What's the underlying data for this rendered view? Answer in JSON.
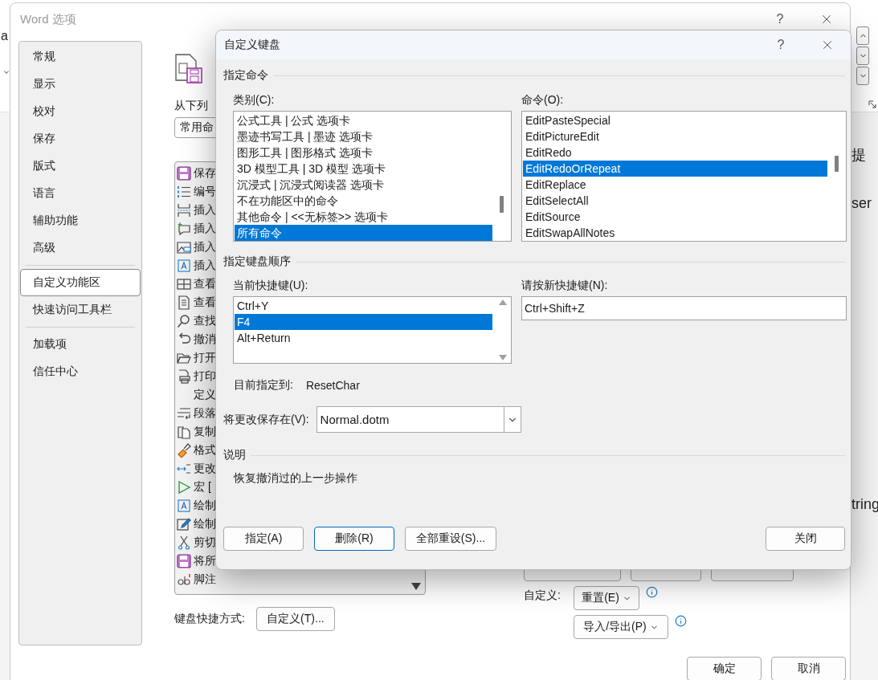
{
  "background": {
    "fragments": [
      "a",
      "提",
      "ser",
      "tring"
    ]
  },
  "options_dialog": {
    "title": "Word 选项",
    "help": "?",
    "nav": [
      {
        "label": "常规",
        "selected": false,
        "divider_after": false
      },
      {
        "label": "显示",
        "selected": false,
        "divider_after": false
      },
      {
        "label": "校对",
        "selected": false,
        "divider_after": false
      },
      {
        "label": "保存",
        "selected": false,
        "divider_after": false
      },
      {
        "label": "版式",
        "selected": false,
        "divider_after": false
      },
      {
        "label": "语言",
        "selected": false,
        "divider_after": false
      },
      {
        "label": "辅助功能",
        "selected": false,
        "divider_after": false
      },
      {
        "label": "高级",
        "selected": false,
        "divider_after": true
      },
      {
        "label": "自定义功能区",
        "selected": true,
        "divider_after": false
      },
      {
        "label": "快速访问工具栏",
        "selected": false,
        "divider_after": true
      },
      {
        "label": "加载项",
        "selected": false,
        "divider_after": false
      },
      {
        "label": "信任中心",
        "selected": false,
        "divider_after": false
      }
    ],
    "source_label": "从下列",
    "source_select": "常用命",
    "commands": [
      {
        "label": "保存",
        "kind": "save"
      },
      {
        "label": "编号",
        "kind": "numbering"
      },
      {
        "label": "插入",
        "kind": "pagebreak"
      },
      {
        "label": "插入",
        "kind": "comment"
      },
      {
        "label": "插入",
        "kind": "picture"
      },
      {
        "label": "插入",
        "kind": "textbox"
      },
      {
        "label": "查看",
        "kind": "columns"
      },
      {
        "label": "查看",
        "kind": "page"
      },
      {
        "label": "查找",
        "kind": "search"
      },
      {
        "label": "撤消",
        "kind": "undo"
      },
      {
        "label": "打开",
        "kind": "folder"
      },
      {
        "label": "打印",
        "kind": "print"
      },
      {
        "label": "定义",
        "kind": "none"
      },
      {
        "label": "段落",
        "kind": "paragraph"
      },
      {
        "label": "复制",
        "kind": "copy"
      },
      {
        "label": "格式",
        "kind": "brush"
      },
      {
        "label": "更改",
        "kind": "arrows"
      },
      {
        "label": "宏 [",
        "kind": "play"
      },
      {
        "label": "绘制",
        "kind": "textbox"
      },
      {
        "label": "绘制",
        "kind": "pencil"
      },
      {
        "label": "剪切",
        "kind": "scissors"
      },
      {
        "label": "将所",
        "kind": "save"
      },
      {
        "label": "脚注",
        "kind": "footnote"
      }
    ],
    "keyboard_label": "键盘快捷方式:",
    "keyboard_button": "自定义(T)...",
    "customize_label": "自定义:",
    "reset_button": "重置(E)",
    "import_button": "导入/导出(P)",
    "ok_button": "确定",
    "cancel_button": "取消"
  },
  "keyboard_dialog": {
    "title": "自定义键盘",
    "help": "?",
    "command_section": "指定命令",
    "categories_label": "类别(C):",
    "categories": [
      {
        "label": "公式工具 | 公式 选项卡",
        "selected": false
      },
      {
        "label": "墨迹书写工具 | 墨迹 选项卡",
        "selected": false
      },
      {
        "label": "图形工具 | 图形格式 选项卡",
        "selected": false
      },
      {
        "label": "3D 模型工具 | 3D 模型 选项卡",
        "selected": false
      },
      {
        "label": "沉浸式 | 沉浸式阅读器 选项卡",
        "selected": false
      },
      {
        "label": "不在功能区中的命令",
        "selected": false
      },
      {
        "label": "其他命令 | <<无标签>> 选项卡",
        "selected": false
      },
      {
        "label": "所有命令",
        "selected": true
      }
    ],
    "commands_label": "命令(O):",
    "commands": [
      {
        "label": "EditPasteSpecial",
        "selected": false
      },
      {
        "label": "EditPictureEdit",
        "selected": false
      },
      {
        "label": "EditRedo",
        "selected": false
      },
      {
        "label": "EditRedoOrRepeat",
        "selected": true
      },
      {
        "label": "EditReplace",
        "selected": false
      },
      {
        "label": "EditSelectAll",
        "selected": false
      },
      {
        "label": "EditSource",
        "selected": false
      },
      {
        "label": "EditSwapAllNotes",
        "selected": false
      }
    ],
    "sequence_section": "指定键盘顺序",
    "current_keys_label": "当前快捷键(U):",
    "current_keys": [
      {
        "label": "Ctrl+Y",
        "selected": false
      },
      {
        "label": "F4",
        "selected": true
      },
      {
        "label": "Alt+Return",
        "selected": false
      }
    ],
    "new_key_label": "请按新快捷键(N):",
    "new_key": {
      "value": "Ctrl+Shift+Z"
    },
    "assigned_label": "目前指定到:",
    "assigned_value": "ResetChar",
    "save_label": "将更改保存在(V):",
    "save_select": "Normal.dotm",
    "description_section": "说明",
    "description": "恢复撤消过的上一步操作",
    "buttons": [
      {
        "label": "指定(A)",
        "focused": false
      },
      {
        "label": "删除(R)",
        "focused": true
      },
      {
        "label": "全部重设(S)...",
        "focused": false
      }
    ],
    "close_button": "关闭"
  }
}
